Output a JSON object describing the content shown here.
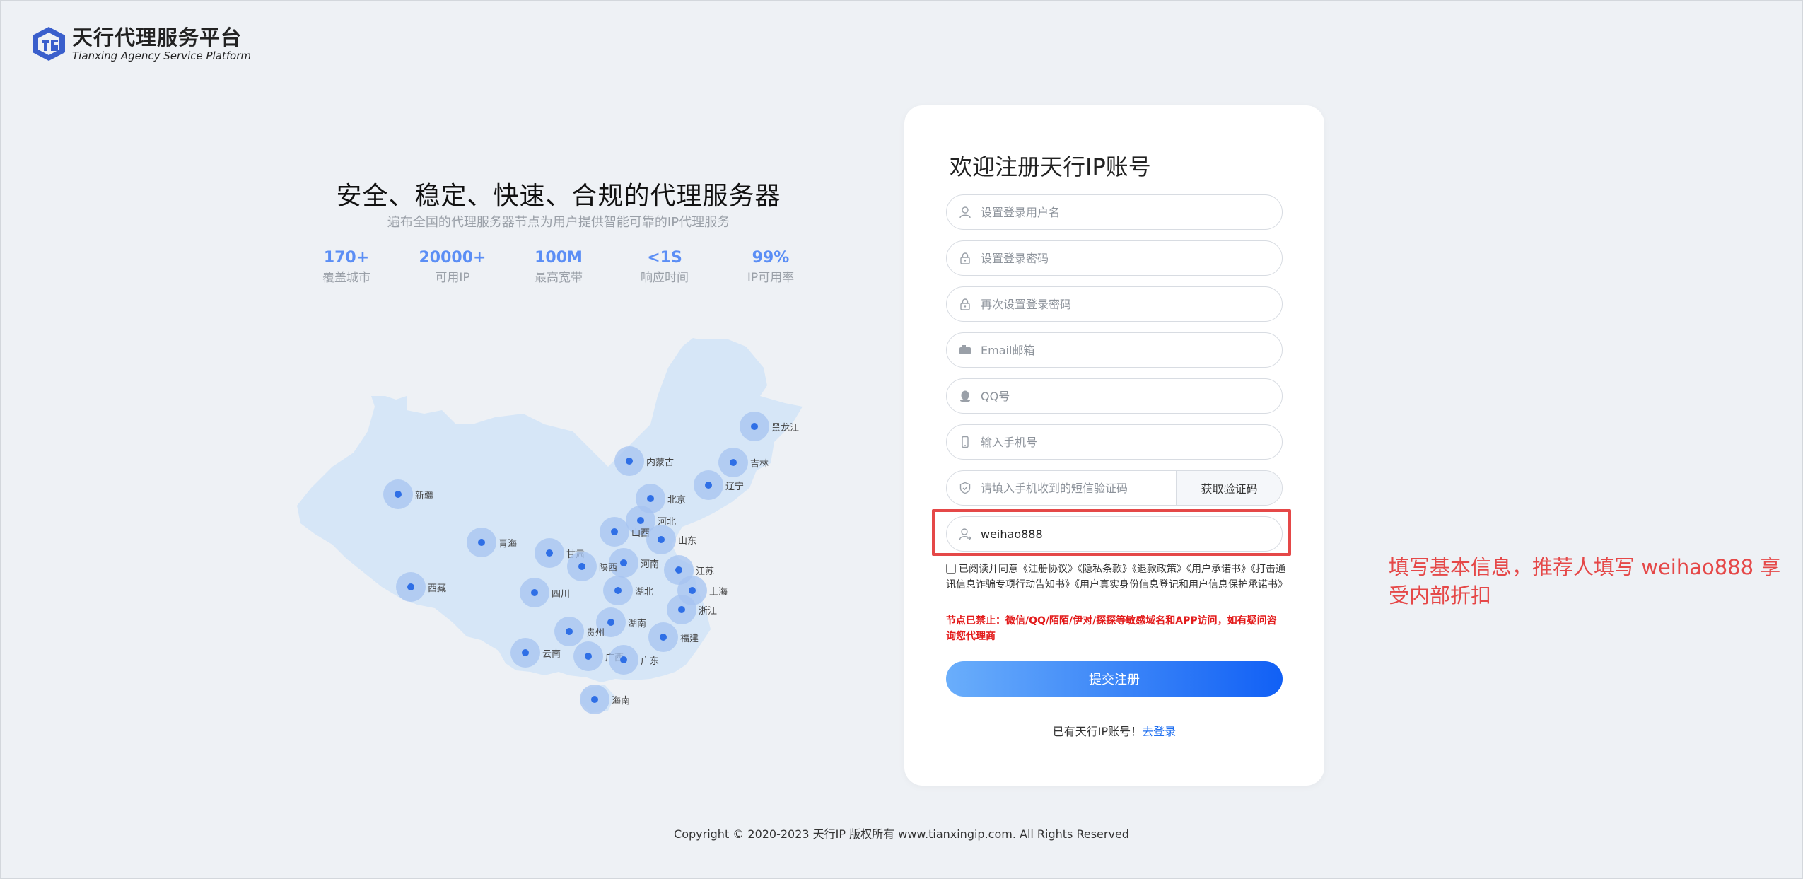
{
  "logo": {
    "title_cn": "天行代理服务平台",
    "title_en": "Tianxing Agency Service Platform"
  },
  "hero": {
    "title": "安全、稳定、快速、合规的代理服务器",
    "subtitle": "遍布全国的代理服务器节点为用户提供智能可靠的IP代理服务",
    "stats": [
      {
        "value": "170+",
        "label": "覆盖城市"
      },
      {
        "value": "20000+",
        "label": "可用IP"
      },
      {
        "value": "100M",
        "label": "最高宽带"
      },
      {
        "value": "<1S",
        "label": "响应时间"
      },
      {
        "value": "99%",
        "label": "IP可用率"
      }
    ]
  },
  "map": {
    "cities": [
      "黑龙江",
      "吉林",
      "内蒙古",
      "辽宁",
      "北京",
      "新疆",
      "河北",
      "山西",
      "山东",
      "青海",
      "甘肃",
      "河南",
      "陕西",
      "江苏",
      "西藏",
      "四川",
      "湖北",
      "上海",
      "浙江",
      "湖南",
      "贵州",
      "福建",
      "云南",
      "广西",
      "广东",
      "海南"
    ]
  },
  "form": {
    "title": "欢迎注册天行IP账号",
    "fields": [
      {
        "placeholder": "设置登录用户名",
        "value": "",
        "icon": "user-icon"
      },
      {
        "placeholder": "设置登录密码",
        "value": "",
        "icon": "lock-icon"
      },
      {
        "placeholder": "再次设置登录密码",
        "value": "",
        "icon": "lock-icon"
      },
      {
        "placeholder": "Email邮箱",
        "value": "",
        "icon": "mailbox-icon"
      },
      {
        "placeholder": "QQ号",
        "value": "",
        "icon": "qq-icon"
      },
      {
        "placeholder": "输入手机号",
        "value": "",
        "icon": "phone-icon"
      },
      {
        "placeholder": "请填入手机收到的短信验证码",
        "value": "",
        "icon": "shield-check-icon"
      },
      {
        "placeholder": "",
        "value": "weihao888",
        "icon": "user-referrer-icon"
      }
    ],
    "get_code_label": "获取验证码",
    "agreement": "已阅读并同意《注册协议》《隐私条款》《退款政策》《用户承诺书》《打击通讯信息诈骗专项行动告知书》《用户真实身份信息登记和用户信息保护承诺书》",
    "warning": "节点已禁止：微信/QQ/陌陌/伊对/探探等敏感域名和APP访问，如有疑问咨询您代理商",
    "submit_label": "提交注册",
    "login_prompt": "已有天行IP账号！",
    "login_link": "去登录"
  },
  "annotation": "填写基本信息，推荐人填写 weihao888 享受内部折扣",
  "footer": "Copyright © 2020-2023 天行IP 版权所有 www.tianxingip.com. All Rights Reserved",
  "colors": {
    "background": "#eef1f5",
    "accent": "#1f6ff0",
    "stat": "#5b8ef5",
    "map_fill": "#d6e6f7",
    "warning": "#e31b1b",
    "annotation": "#e54848"
  }
}
